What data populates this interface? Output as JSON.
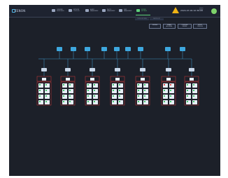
{
  "app": {
    "logo_text": "ZENON",
    "datetime": "2024-07-09 10:36:08",
    "user": "admin\nonline"
  },
  "nav": [
    {
      "label": "OVERVIEW\nMONITORING",
      "icon": "dashboard-icon"
    },
    {
      "label": "NETWORK\nTOPOLOGY",
      "icon": "network-icon"
    },
    {
      "label": "ALARM\nMANAGEMENT",
      "icon": "alarm-icon"
    },
    {
      "label": "DEVICE\nMANAGEMENT",
      "icon": "device-icon"
    },
    {
      "label": "USER\nMANAGEMENT",
      "icon": "shield-icon"
    },
    {
      "label": "SYSTEM\nSETTINGS",
      "icon": "settings-icon",
      "active": true
    }
  ],
  "subtabs": [
    "TOPOLOGY VIEW",
    "DEVICE LIST"
  ],
  "actions": [
    "REFRESH",
    "EXPAND\nALL NODES",
    "CONFIGURE\nDEVICES",
    "EXPORT\nTOPOLOGY"
  ],
  "colors": {
    "accent": "#5fd07a",
    "link": "#3ea8df",
    "alert": "#d23a3a",
    "warning": "#f0b315"
  }
}
